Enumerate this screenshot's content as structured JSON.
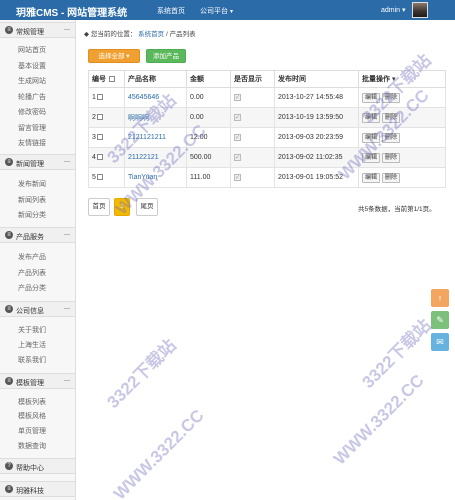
{
  "header": {
    "title": "玥雅CMS - 网站管理系统",
    "nav": [
      {
        "label": "系统首页",
        "caret": ""
      },
      {
        "label": "公司平台",
        "caret": "▾"
      }
    ],
    "user": "admin ▾"
  },
  "sidebar": {
    "groups": [
      {
        "icon": "≡",
        "label": "常规管理",
        "toggle": "—",
        "items": [
          "网站首页",
          "基本设置",
          "生成网站",
          "轮播广告",
          "修改密码",
          "留言管理",
          "友情链接"
        ]
      },
      {
        "icon": "≡",
        "label": "新闻管理",
        "toggle": "—",
        "items": [
          "发布新闻",
          "新闻列表",
          "新闻分类"
        ]
      },
      {
        "icon": "≡",
        "label": "产品服务",
        "toggle": "—",
        "items": [
          "发布产品",
          "产品列表",
          "产品分类"
        ]
      },
      {
        "icon": "≡",
        "label": "公司信息",
        "toggle": "—",
        "items": [
          "关于我们",
          "上海生活",
          "联系我们"
        ]
      },
      {
        "icon": "≡",
        "label": "模板管理",
        "toggle": "—",
        "items": [
          "模板列表",
          "模板风格",
          "单页管理",
          "数据查询"
        ]
      },
      {
        "icon": "?",
        "label": "帮助中心",
        "toggle": "",
        "items": []
      },
      {
        "icon": "≡",
        "label": "玥雅科技",
        "toggle": "",
        "items": []
      }
    ]
  },
  "breadcrumb": {
    "prefix": "您当前的位置：",
    "link": "系统首页",
    "sep": "/",
    "current": "产品列表"
  },
  "toolbar": {
    "select_all": "选择全部 ▾",
    "add": "添加产品"
  },
  "table": {
    "headers": [
      "编号",
      "产品名称",
      "金额",
      "是否显示",
      "发布时间",
      "批量操作 ▾"
    ],
    "rows": [
      {
        "id": "1",
        "name": "45645646",
        "amount": "0.00",
        "shown": "✓",
        "time": "2013-10-27 14:55:48",
        "edit": "编辑",
        "del": "删除"
      },
      {
        "id": "2",
        "name": "啊啊啊",
        "amount": "0.00",
        "shown": "✓",
        "time": "2013-10-19 13:59:50",
        "edit": "编辑",
        "del": "删除"
      },
      {
        "id": "3",
        "name": "2121121211",
        "amount": "12.00",
        "shown": "✓",
        "time": "2013-09-03 20:23:59",
        "edit": "编辑",
        "del": "删除"
      },
      {
        "id": "4",
        "name": "21122121",
        "amount": "500.00",
        "shown": "✓",
        "time": "2013-09-02 11:02:35",
        "edit": "编辑",
        "del": "删除"
      },
      {
        "id": "5",
        "name": "TianYuan",
        "amount": "111.00",
        "shown": "✓",
        "time": "2013-09-01 19:05:52",
        "edit": "编辑",
        "del": "删除"
      }
    ]
  },
  "pagination": {
    "first": "首页",
    "current": "1",
    "last": "尾页",
    "summary": "共5条数据，当前第1/1页。"
  },
  "floating": {
    "top_icon": "↑",
    "share_icon": "✎",
    "chat_icon": "✉",
    "colors": {
      "top": "#f2a660",
      "share": "#7cc07c",
      "chat": "#66b3e0"
    }
  },
  "watermark": "WWW.3322.CC",
  "watermark_cn": "3322下载站"
}
